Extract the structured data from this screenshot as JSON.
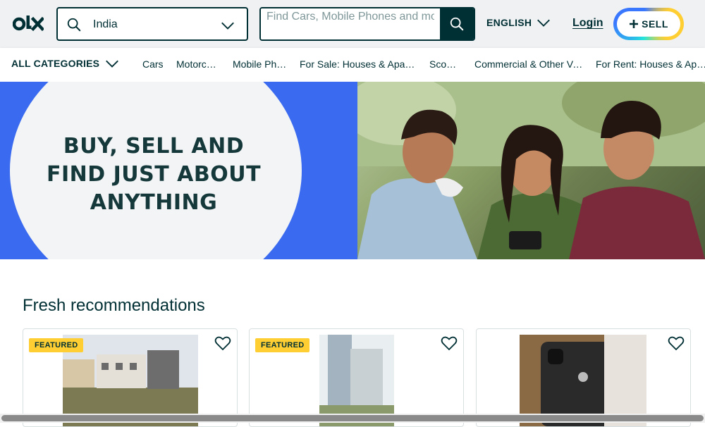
{
  "header": {
    "location_value": "India",
    "search_placeholder": "Find Cars, Mobile Phones and more...",
    "language": "ENGLISH",
    "login": "Login",
    "sell": "SELL"
  },
  "categories": {
    "all": "ALL CATEGORIES",
    "items": [
      "Cars",
      "Motorcycles",
      "Mobile Phones",
      "For Sale: Houses & Apartments",
      "Scooters",
      "Commercial & Other Vehicles",
      "For Rent: Houses & Apartments"
    ]
  },
  "banner": {
    "line1": "BUY, SELL AND",
    "line2": "FIND JUST ABOUT",
    "line3": "ANYTHING"
  },
  "fresh": {
    "title": "Fresh recommendations",
    "cards": [
      {
        "badge": "FEATURED"
      },
      {
        "badge": "FEATURED"
      },
      {
        "badge": ""
      }
    ]
  },
  "colors": {
    "brand_dark": "#002f34",
    "header_bg": "#eff1f3",
    "banner_blue": "#3a6af0",
    "featured_yellow": "#ffce32"
  }
}
